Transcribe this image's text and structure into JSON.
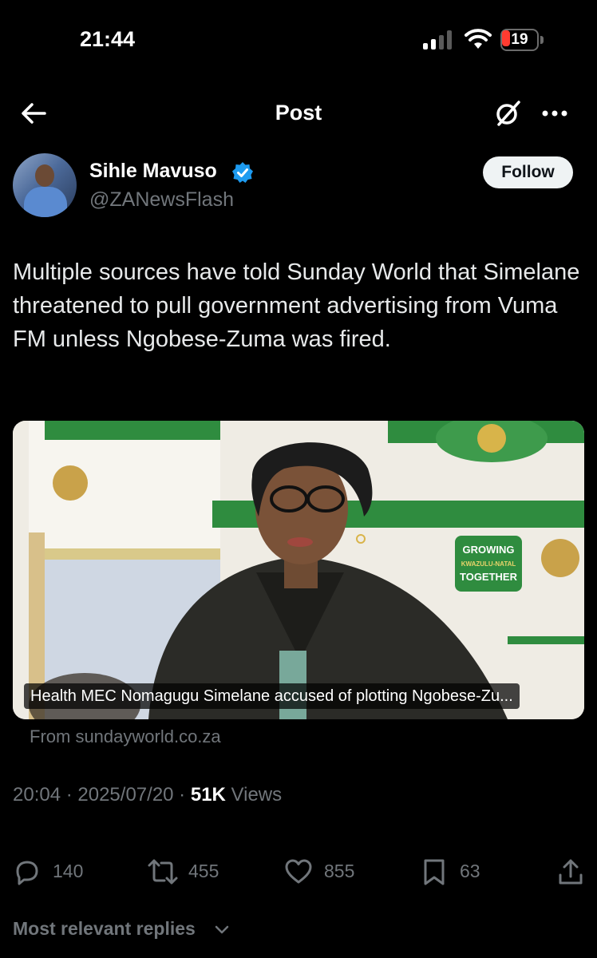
{
  "status_bar": {
    "time": "21:44",
    "battery": "19"
  },
  "nav": {
    "title": "Post"
  },
  "author": {
    "name": "Sihle Mavuso",
    "handle": "@ZANewsFlash",
    "follow_label": "Follow",
    "verified": true
  },
  "post": {
    "text": "Multiple sources have told Sunday World that Simelane threatened to pull government advertising from Vuma FM unless Ngobese-Zuma was fired."
  },
  "card": {
    "caption": "Health MEC Nomagugu Simelane accused of plotting Ngobese-Zu...",
    "source": "From sundayworld.co.za",
    "banner_text": [
      "GROWING",
      "KWAZULU-NATAL",
      "TOGETHER"
    ]
  },
  "meta": {
    "time": "20:04",
    "date": "2025/07/20",
    "views_count": "51K",
    "views_label": "Views"
  },
  "actions": {
    "replies": "140",
    "reposts": "455",
    "likes": "855",
    "bookmarks": "63"
  },
  "replies_filter": {
    "label": "Most relevant replies"
  },
  "colors": {
    "background": "#000000",
    "text": "#e7e9ea",
    "muted": "#71767b",
    "verified": "#1d9bf0",
    "battery_low": "#ff3b30"
  }
}
